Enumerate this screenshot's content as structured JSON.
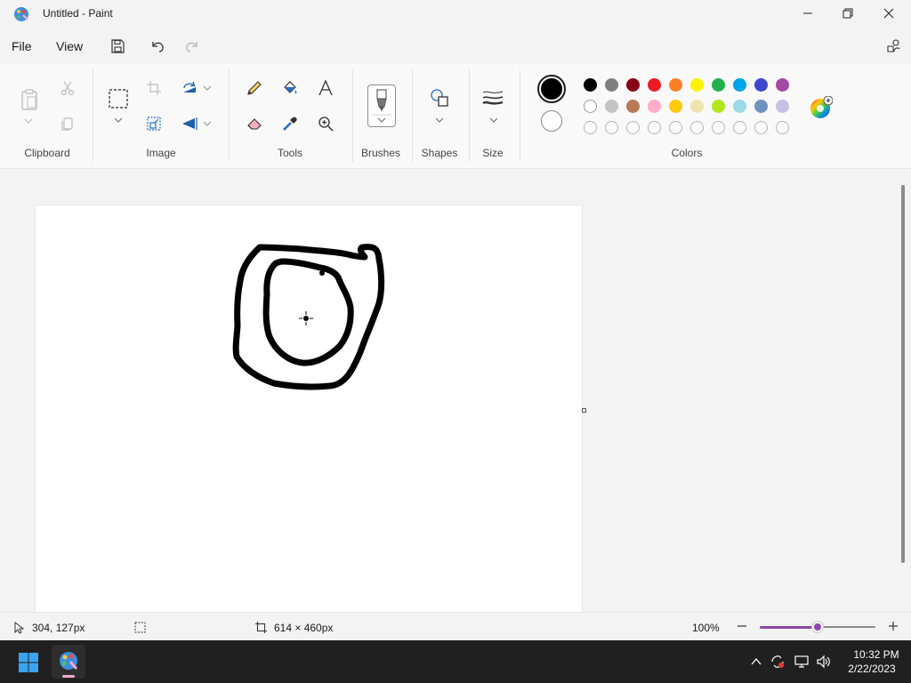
{
  "window": {
    "title": "Untitled - Paint"
  },
  "menu": {
    "file": "File",
    "view": "View"
  },
  "ribbon": {
    "groups": {
      "clipboard": "Clipboard",
      "image": "Image",
      "tools": "Tools",
      "brushes": "Brushes",
      "shapes": "Shapes",
      "size": "Size",
      "colors": "Colors"
    },
    "primary_color": "#000000",
    "secondary_color": "#ffffff",
    "palette_row1": [
      "#000000",
      "#7f7f7f",
      "#880015",
      "#ed1c24",
      "#ff7f27",
      "#fff200",
      "#22b14c",
      "#00a2e8",
      "#3f48cc",
      "#a349a4"
    ],
    "palette_row2": [
      "#ffffff",
      "#c3c3c3",
      "#b97a57",
      "#ffaec9",
      "#ffc90e",
      "#efe4b0",
      "#b5e61d",
      "#99d9ea",
      "#7092be",
      "#c8bfe7"
    ],
    "palette_row3_count": 10
  },
  "status": {
    "cursor_position": "304, 127px",
    "canvas_size": "614 × 460px",
    "zoom": "100%",
    "zoom_level": 0.5
  },
  "taskbar": {
    "time": "10:32 PM",
    "date": "2/22/2023"
  },
  "colors": {
    "accent": "#8e44ad",
    "taskbar_bg": "#202020"
  }
}
